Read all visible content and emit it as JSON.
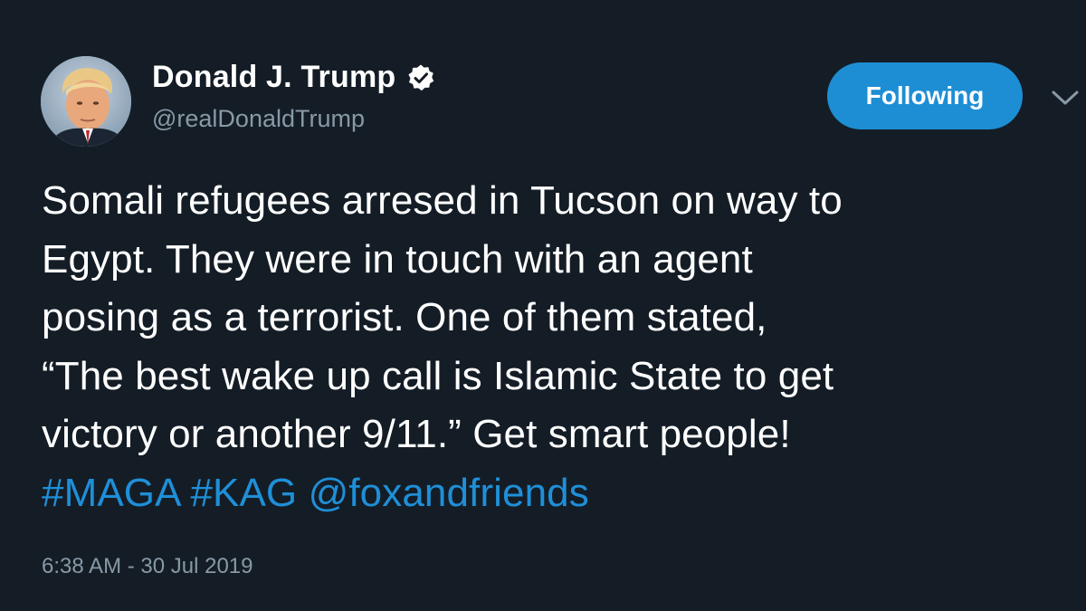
{
  "user": {
    "display_name": "Donald J. Trump",
    "handle": "@realDonaldTrump",
    "verified": true
  },
  "follow_button": {
    "label": "Following",
    "color": "#1d8ed4"
  },
  "tweet": {
    "lines": [
      "Somali refugees arresed in Tucson on way to",
      "Egypt. They were in touch with an agent",
      "posing as a terrorist. One of them stated,",
      "“The best wake up call is Islamic State to get",
      "victory or another 9/11.” Get smart people!"
    ],
    "entities": [
      "#MAGA",
      "#KAG",
      "@foxandfriends"
    ],
    "link_color": "#1f8fd8"
  },
  "timestamp": "6:38 AM - 30 Jul 2019",
  "icons": {
    "verified": "verified-badge-icon",
    "menu": "chevron-down-icon",
    "avatar": "profile-avatar"
  },
  "colors": {
    "background": "#141d26",
    "text": "#ffffff",
    "secondary": "#8899a6"
  }
}
